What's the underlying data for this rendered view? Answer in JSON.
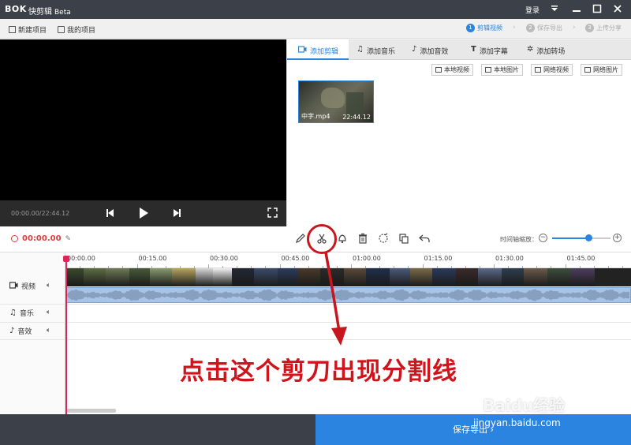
{
  "titlebar": {
    "logo": "BOK",
    "app_name": "快剪辑",
    "beta": "Beta",
    "login": "登录",
    "menu_icon": "dropdown-triangle-icon",
    "minimize_icon": "minimize-icon",
    "maximize_icon": "maximize-icon",
    "close_icon": "close-icon",
    "bg_color": "#3c4048"
  },
  "toolbar": {
    "new_project": "新建项目",
    "my_projects": "我的项目",
    "steps": [
      {
        "num": "1",
        "label": "剪辑视频",
        "state": "active"
      },
      {
        "num": "2",
        "label": "保存导出",
        "state": "inactive"
      },
      {
        "num": "3",
        "label": "上传分享",
        "state": "inactive"
      }
    ]
  },
  "player": {
    "timecode": "00:00.00/22:44.12",
    "prev_icon": "skip-back-icon",
    "play_icon": "play-icon",
    "next_icon": "skip-forward-icon",
    "fullscreen_icon": "fullscreen-icon"
  },
  "media_panel": {
    "tabs": [
      {
        "label": "添加剪辑",
        "icon": "video-camera-icon",
        "active": true
      },
      {
        "label": "添加音乐",
        "icon": "music-note-icon",
        "active": false
      },
      {
        "label": "添加音效",
        "icon": "sound-effect-icon",
        "active": false
      },
      {
        "label": "添加字幕",
        "icon": "text-icon",
        "active": false
      },
      {
        "label": "添加转场",
        "icon": "transition-icon",
        "active": false
      }
    ],
    "source_buttons": [
      "本地视频",
      "本地图片",
      "网络视频",
      "网络图片"
    ],
    "clip": {
      "filename": "中字.mp4",
      "duration": "22:44.12"
    }
  },
  "timeline_toolbar": {
    "current_time": "00:00.00",
    "tools": [
      "pencil-icon",
      "scissors-icon",
      "bell-icon",
      "trash-icon",
      "crop-icon",
      "copy-icon",
      "undo-icon"
    ],
    "zoom_label": "时间轴缩放：",
    "zoom_out": "−",
    "zoom_in": "+",
    "zoom_level": 0.62
  },
  "timeline": {
    "ruler_ticks": [
      "00:00.00",
      "00:15.00",
      "00:30.00",
      "00:45.00",
      "01:00.00",
      "01:15.00",
      "01:30.00",
      "01:45.00"
    ],
    "tracks": [
      {
        "label": "视频",
        "icon": "video-camera-icon"
      },
      {
        "label": "音乐",
        "icon": "music-note-icon"
      },
      {
        "label": "音效",
        "icon": "sound-effect-icon"
      }
    ]
  },
  "bottom_bar": {
    "save_export": "保存导出 ›",
    "accent": "#2a84e0"
  },
  "annotation": {
    "text": "点击这个剪刀出现分割线",
    "color": "#d0141c"
  },
  "watermark": {
    "brand": "Baidu经验",
    "url": "jingyan.baidu.com"
  }
}
